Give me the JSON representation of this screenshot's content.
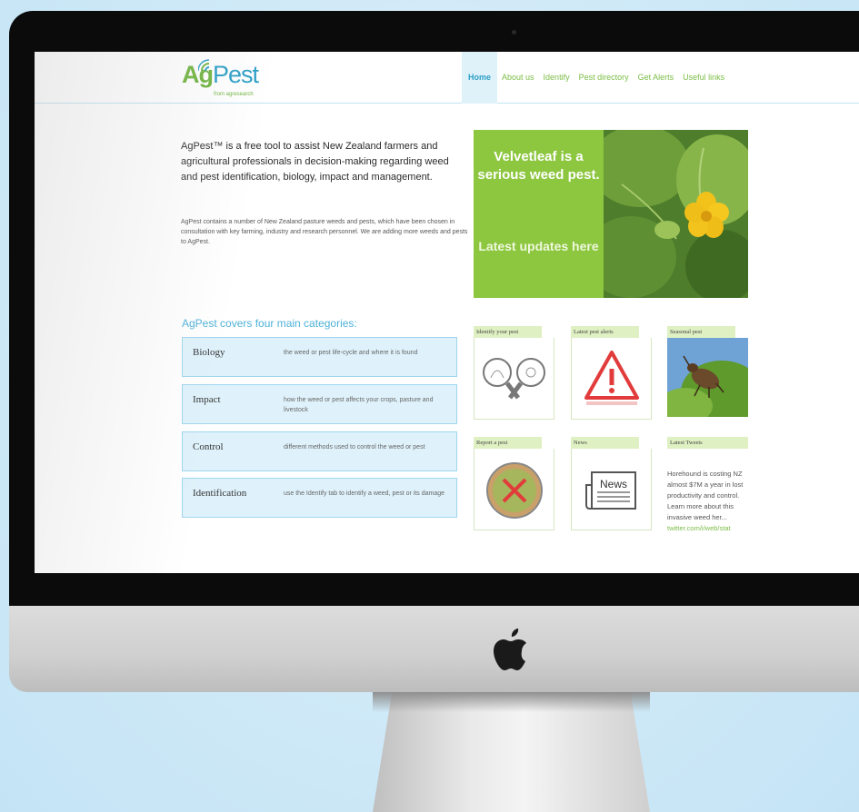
{
  "site": {
    "logo_ag": "Ag",
    "logo_pest": "Pest",
    "logo_sub": "from agresearch"
  },
  "nav": {
    "items": [
      {
        "label": "Home",
        "active": true
      },
      {
        "label": "About us"
      },
      {
        "label": "Identify"
      },
      {
        "label": "Pest directory"
      },
      {
        "label": "Get Alerts"
      },
      {
        "label": "Useful links"
      }
    ]
  },
  "intro": {
    "lead": "AgPest™ is a free tool to assist New Zealand farmers and agricultural professionals in decision-making regarding weed and pest identification, biology, impact and management.",
    "body": "AgPest contains a number of New Zealand pasture weeds and pests, which have been chosen in consultation with key farming, industry and research personnel. We are adding more weeds and pests to AgPest."
  },
  "banner": {
    "title": "Velvetleaf is a serious weed pest.",
    "cta": "Latest updates here"
  },
  "categories": {
    "heading": "AgPest covers four main categories:",
    "items": [
      {
        "name": "Biology",
        "desc": "the weed or pest life-cycle and where it is found"
      },
      {
        "name": "Impact",
        "desc": "how the weed or pest affects your crops, pasture and livestock"
      },
      {
        "name": "Control",
        "desc": "different methods used to control the weed or pest"
      },
      {
        "name": "Identification",
        "desc": "use the Identify tab to identify a weed, pest or its damage"
      }
    ]
  },
  "tiles": {
    "identify": "Identify your pest",
    "alerts": "Latest pest alerts",
    "seasonal": "Seasonal pest",
    "report": "Report a pest",
    "news": "News",
    "news_icon_text": "News",
    "tweets": "Latest Tweets"
  },
  "tweet": {
    "text": "Horehound is costing NZ almost $7M a year in lost productivity and control. Learn more about this invasive weed her...",
    "link": "twitter.com/i/web/stat"
  },
  "colors": {
    "brand_green": "#7cbd46",
    "brand_blue": "#2d9fc6",
    "banner_green": "#8dc63f",
    "alert_red": "#e23b3b"
  }
}
